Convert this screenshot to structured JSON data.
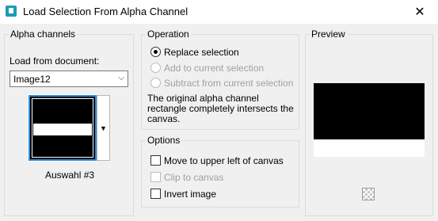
{
  "window": {
    "title": "Load Selection From Alpha Channel",
    "close_glyph": "✕",
    "app_icon": "paintshop-icon"
  },
  "alpha_channels": {
    "group_title": "Alpha channels",
    "load_from_label": "Load from document:",
    "document_value": "Image12",
    "dropdown_arrow": "⌵",
    "thumb_dropdown_arrow": "▼",
    "selection_name": "Auswahl #3"
  },
  "operation": {
    "group_title": "Operation",
    "options": [
      {
        "label": "Replace selection",
        "selected": true,
        "enabled": true
      },
      {
        "label": "Add to current selection",
        "selected": false,
        "enabled": false
      },
      {
        "label": "Subtract from current selection",
        "selected": false,
        "enabled": false
      }
    ],
    "description": "The original alpha channel rectangle completely intersects the canvas."
  },
  "options": {
    "group_title": "Options",
    "items": [
      {
        "label": "Move to upper left of canvas",
        "checked": false,
        "enabled": true
      },
      {
        "label": "Clip to canvas",
        "checked": false,
        "enabled": false
      },
      {
        "label": "Invert image",
        "checked": false,
        "enabled": true
      }
    ]
  },
  "preview": {
    "group_title": "Preview"
  }
}
